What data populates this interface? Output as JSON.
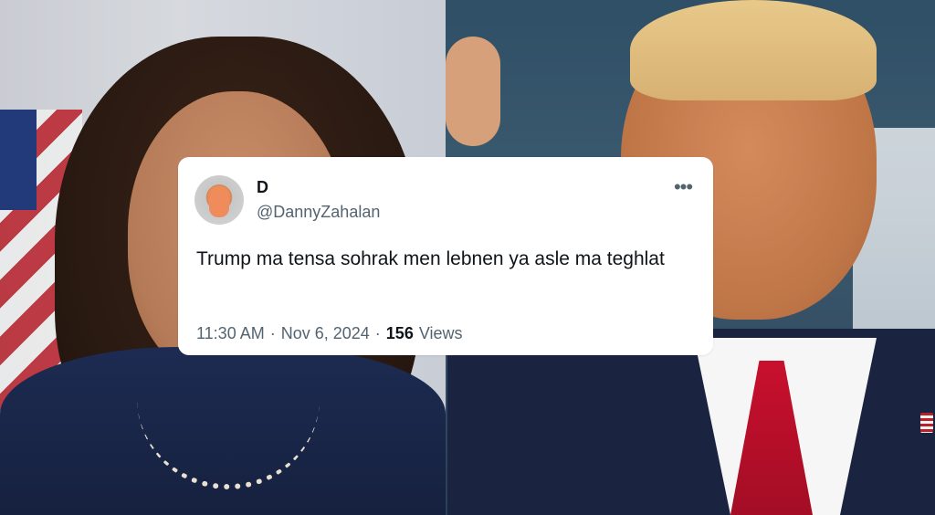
{
  "tweet": {
    "display_name": "D",
    "handle": "@DannyZahalan",
    "text": "Trump ma tensa sohrak men lebnen ya asle ma teghlat",
    "time": "11:30 AM",
    "date": "Nov 6, 2024",
    "separator": "·",
    "views_count": "156",
    "views_label": "Views",
    "more_icon": "more-horizontal-icon"
  },
  "colors": {
    "card_background": "#ffffff",
    "primary_text": "#0f1419",
    "secondary_text": "#536471"
  }
}
